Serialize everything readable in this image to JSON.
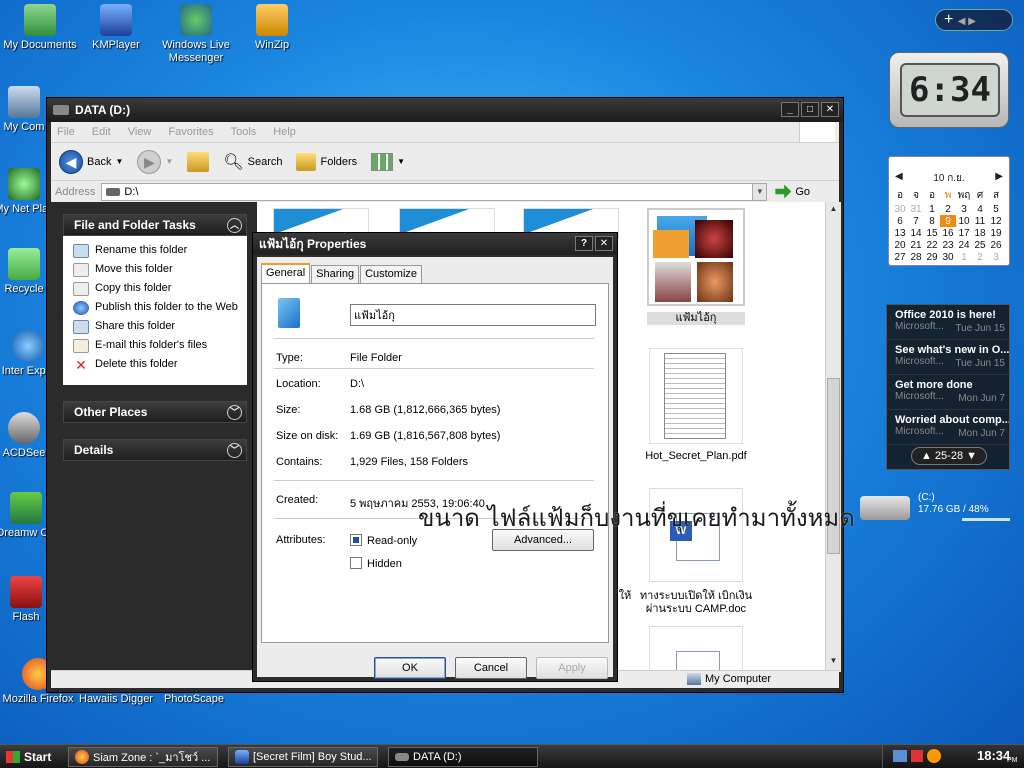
{
  "desktop": {
    "icons": [
      {
        "label": "My Documents"
      },
      {
        "label": "KMPlayer"
      },
      {
        "label": "Windows Live Messenger"
      },
      {
        "label": "WinZip"
      },
      {
        "label": "My Com"
      },
      {
        "label": "My Net Plac"
      },
      {
        "label": "Recycle"
      },
      {
        "label": "Inter Explo"
      },
      {
        "label": "ACDSee"
      },
      {
        "label": "Dreamw CS"
      },
      {
        "label": "Flash"
      },
      {
        "label": "Mozilla Firefox"
      },
      {
        "label": "Hawaiis Digger"
      },
      {
        "label": "PhotoScape"
      }
    ]
  },
  "explorer": {
    "title": "DATA (D:)",
    "menu": [
      "File",
      "Edit",
      "View",
      "Favorites",
      "Tools",
      "Help"
    ],
    "toolbar": {
      "back": "Back",
      "search": "Search",
      "folders": "Folders"
    },
    "address_label": "Address",
    "address_value": "D:\\",
    "go_label": "Go",
    "tasks_header": "File and Folder Tasks",
    "tasks": [
      "Rename this folder",
      "Move this folder",
      "Copy this folder",
      "Publish this folder to the Web",
      "Share this folder",
      "E-mail this folder's files",
      "Delete this folder"
    ],
    "other_places": "Other Places",
    "details": "Details",
    "files": [
      {
        "name": "แฟ้มไอ้กุ"
      },
      {
        "name": "Hot_Secret_Plan.pdf"
      },
      {
        "name": "ทางระบบเปิดให้ เบิกเงินผ่านระบบ CAMP.doc"
      },
      {
        "name": "ให้"
      }
    ],
    "status_location": "My Computer"
  },
  "dialog": {
    "title": "แฟ้มไอ้กุ Properties",
    "tabs": [
      "General",
      "Sharing",
      "Customize"
    ],
    "name_value": "แฟ้มไอ้กุ",
    "type_label": "Type:",
    "type_value": "File Folder",
    "location_label": "Location:",
    "location_value": "D:\\",
    "size_label": "Size:",
    "size_value": "1.68 GB (1,812,666,365 bytes)",
    "size_on_disk_label": "Size on disk:",
    "size_on_disk_value": "1.69 GB (1,816,567,808 bytes)",
    "contains_label": "Contains:",
    "contains_value": "1,929 Files, 158 Folders",
    "created_label": "Created:",
    "created_value": "5 พฤษภาคม 2553, 19:06:40",
    "attributes_label": "Attributes:",
    "readonly_label": "Read-only",
    "hidden_label": "Hidden",
    "advanced_label": "Advanced...",
    "ok_label": "OK",
    "cancel_label": "Cancel",
    "apply_label": "Apply"
  },
  "overlay_caption": "ขนาด ไฟล์แฟ้มก็บงานที่ขุเคยทำมาทั้งหมด",
  "gadgets": {
    "clock_time": "6:34",
    "calendar": {
      "month": "10 ก.ย.",
      "weekdays": [
        "อ",
        "จ",
        "อ",
        "พ",
        "พฤ",
        "ศ",
        "ส"
      ],
      "weeks": [
        [
          "30",
          "31",
          "1",
          "2",
          "3",
          "4",
          "5"
        ],
        [
          "6",
          "7",
          "8",
          "9",
          "10",
          "11",
          "12"
        ],
        [
          "13",
          "14",
          "15",
          "16",
          "17",
          "18",
          "19"
        ],
        [
          "20",
          "21",
          "22",
          "23",
          "24",
          "25",
          "26"
        ],
        [
          "27",
          "28",
          "29",
          "30",
          "1",
          "2",
          "3"
        ]
      ]
    },
    "feeds": [
      {
        "title": "Office 2010 is here!",
        "source": "Microsoft...",
        "date": "Tue Jun 15"
      },
      {
        "title": "See what's new in O...",
        "source": "Microsoft...",
        "date": "Tue Jun 15"
      },
      {
        "title": "Get more done",
        "source": "Microsoft...",
        "date": "Mon Jun 7"
      },
      {
        "title": "Worried about comp...",
        "source": "Microsoft...",
        "date": "Mon Jun 7"
      }
    ],
    "feed_pager": "25-28",
    "drive_label": "(C:)",
    "drive_info": "17.76 GB / 48%",
    "drive_used_fraction": 0.48
  },
  "taskbar": {
    "start": "Start",
    "tasks": [
      {
        "label": "Siam Zone : `_มาโชว์ ..."
      },
      {
        "label": "[Secret Film] Boy Stud..."
      },
      {
        "label": "DATA (D:)"
      }
    ],
    "lang": "EN",
    "time": "18:34",
    "ampm": "PM"
  }
}
